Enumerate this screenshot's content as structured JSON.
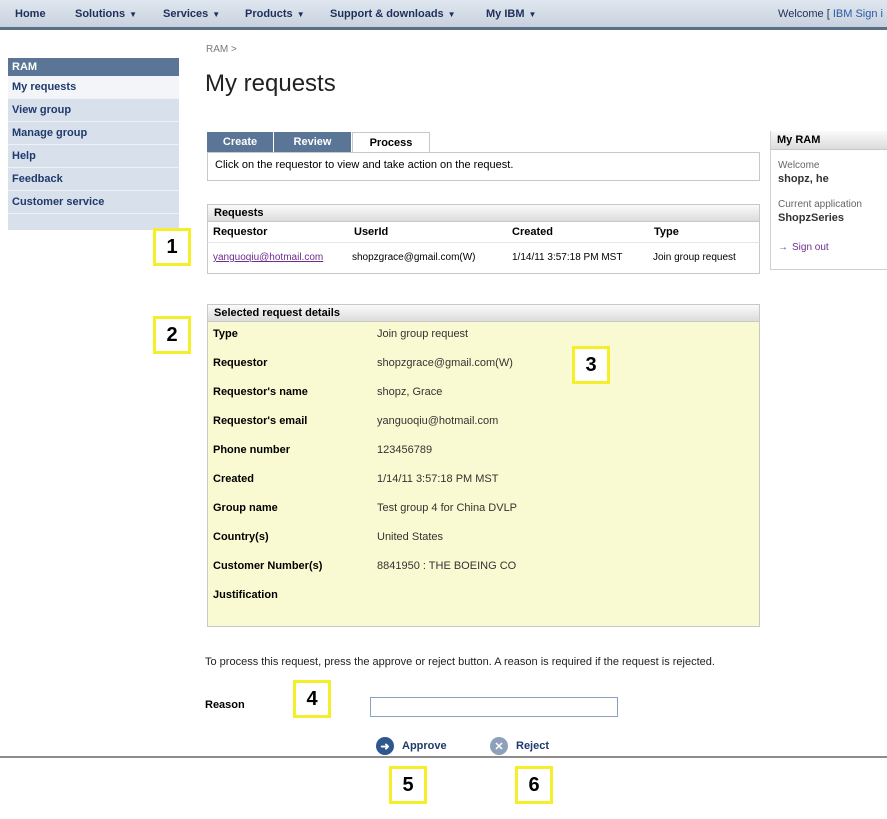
{
  "topnav": {
    "items": [
      "Home",
      "Solutions",
      "Services",
      "Products",
      "Support & downloads",
      "My IBM"
    ],
    "welcome_prefix": "Welcome [",
    "welcome_link": "IBM Sign i"
  },
  "leftnav": {
    "title": "RAM",
    "items": [
      "My requests",
      "View group",
      "Manage group",
      "Help",
      "Feedback",
      "Customer service"
    ]
  },
  "breadcrumb": "RAM >",
  "page_title": "My requests",
  "tabs": [
    "Create",
    "Review",
    "Process"
  ],
  "instructions": "Click on the requestor to view and take action on the request.",
  "requests": {
    "title": "Requests",
    "columns": [
      "Requestor",
      "UserId",
      "Created",
      "Type"
    ],
    "rows": [
      {
        "requestor": "yanguoqiu@hotmail.com",
        "userid": "shopzgrace@gmail.com(W)",
        "created": "1/14/11 3:57:18 PM MST",
        "type": "Join group request"
      }
    ]
  },
  "details": {
    "title": "Selected request details",
    "rows": [
      {
        "label": "Type",
        "value": "Join group request"
      },
      {
        "label": "Requestor",
        "value": "shopzgrace@gmail.com(W)"
      },
      {
        "label": "Requestor's name",
        "value": "shopz, Grace"
      },
      {
        "label": "Requestor's email",
        "value": "yanguoqiu@hotmail.com"
      },
      {
        "label": "Phone number",
        "value": "123456789"
      },
      {
        "label": "Created",
        "value": "1/14/11 3:57:18 PM MST"
      },
      {
        "label": "Group name",
        "value": "Test group 4 for China DVLP"
      },
      {
        "label": "Country(s)",
        "value": "United States"
      },
      {
        "label": "Customer Number(s)",
        "value": "8841950 : THE BOEING CO"
      },
      {
        "label": "Justification",
        "value": ""
      }
    ]
  },
  "process": {
    "note": "To process this request, press the approve or reject button. A reason is required if the request is rejected.",
    "reason_label": "Reason",
    "reason_value": "",
    "approve_label": "Approve",
    "reject_label": "Reject"
  },
  "myram": {
    "title": "My RAM",
    "welcome_label": "Welcome",
    "welcome_value": "shopz, he",
    "app_label": "Current application",
    "app_value": "ShopzSeries",
    "signout": "Sign out"
  },
  "callouts": [
    "1",
    "2",
    "3",
    "4",
    "5",
    "6"
  ],
  "colors": {
    "nav_blue": "#5a7596",
    "panel_yellow": "#fafad2",
    "callout_border": "#f5ef2a"
  }
}
